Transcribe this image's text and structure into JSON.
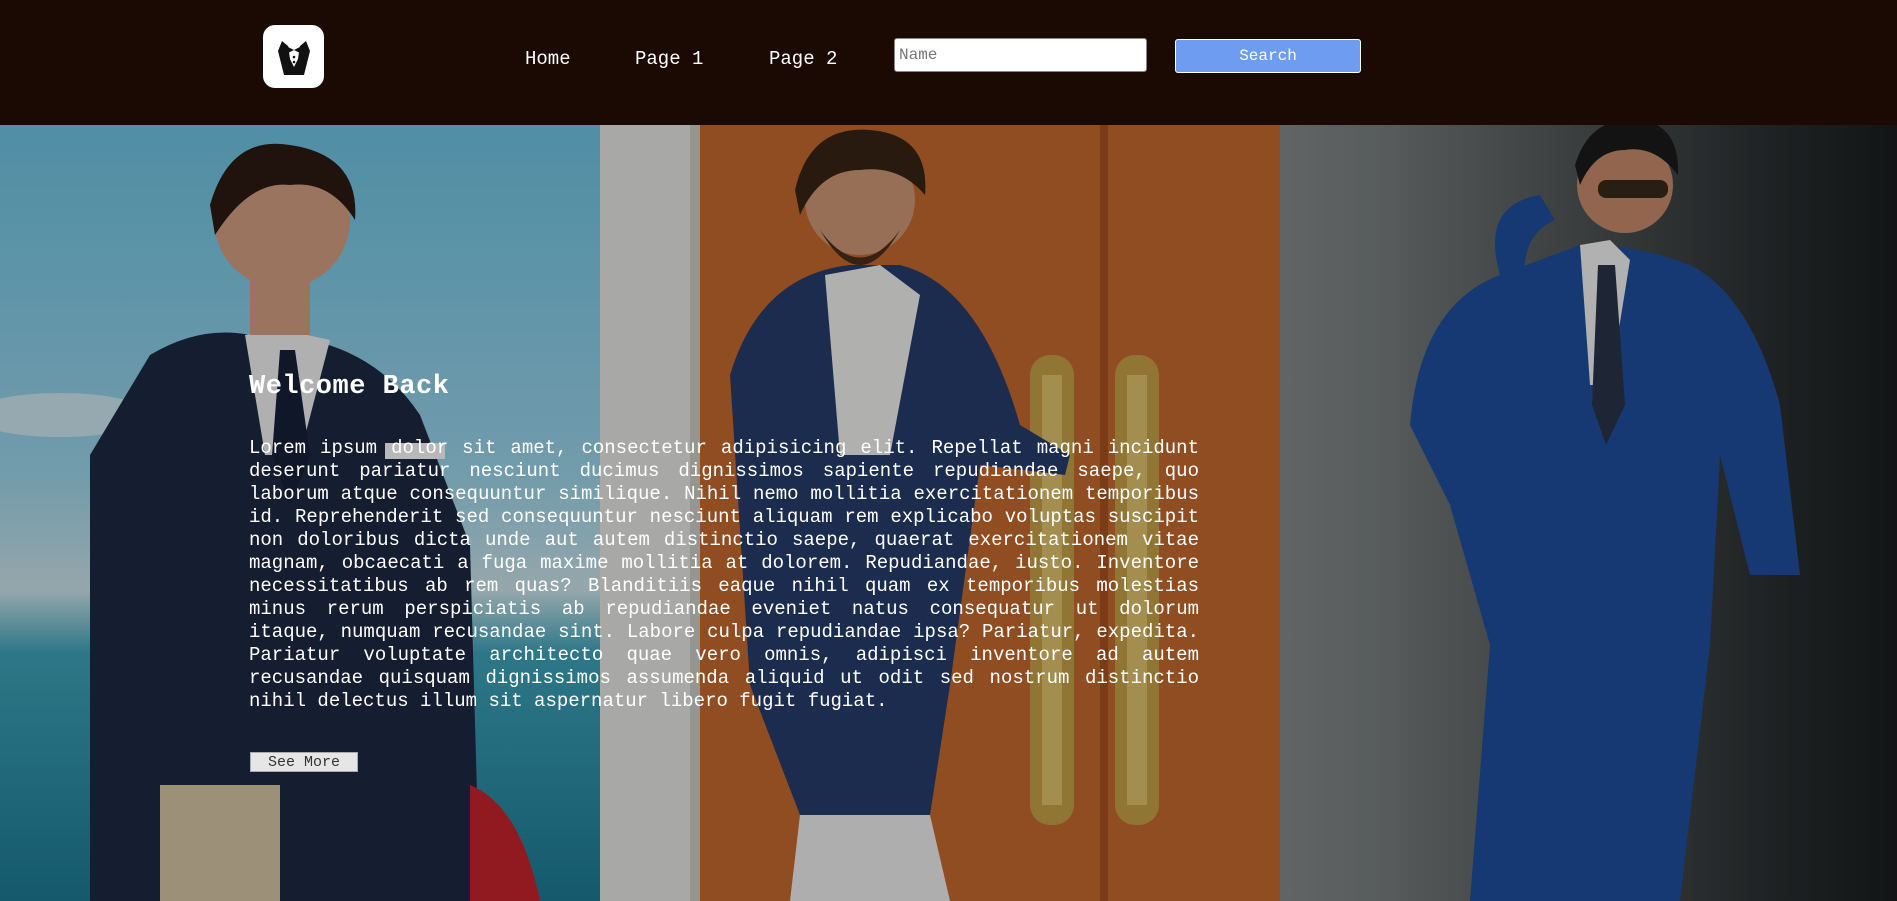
{
  "header": {
    "logo_icon": "tuxedo-icon",
    "nav": [
      {
        "label": "Home"
      },
      {
        "label": "Page 1"
      },
      {
        "label": "Page 2"
      }
    ],
    "search": {
      "placeholder": "Name",
      "value": "",
      "button_label": "Search"
    }
  },
  "hero": {
    "images": [
      "man-navy-blazer-beach-photo",
      "man-floral-blazer-door-photo",
      "man-blue-plaid-suit-photo"
    ],
    "title": "Welcome Back",
    "text": "Lorem ipsum dolor sit amet, consectetur adipisicing elit. Repellat magni incidunt deserunt pariatur nesciunt ducimus dignissimos sapiente repudiandae saepe, quo laborum atque consequuntur similique. Nihil nemo mollitia exercitationem temporibus id. Reprehenderit sed consequuntur nesciunt aliquam rem explicabo voluptas suscipit non doloribus dicta unde aut autem distinctio saepe, quaerat exercitationem vitae magnam, obcaecati a fuga maxime mollitia at dolorem. Repudiandae, iusto. Inventore necessitatibus ab rem quas? Blanditiis eaque nihil quam ex temporibus molestias minus rerum perspiciatis ab repudiandae eveniet natus consequatur ut dolorum itaque, numquam recusandae sint. Labore culpa repudiandae ipsa? Pariatur, expedita. Pariatur voluptate architecto quae vero omnis, adipisci inventore ad autem recusandae quisquam dignissimos assumenda aliquid ut odit sed nostrum distinctio nihil delectus illum sit aspernatur libero fugit fugiat.",
    "button_label": "See More"
  },
  "colors": {
    "header_bg": "#1a0a03",
    "search_button": "#6d9cf0",
    "text": "#ffffff"
  }
}
